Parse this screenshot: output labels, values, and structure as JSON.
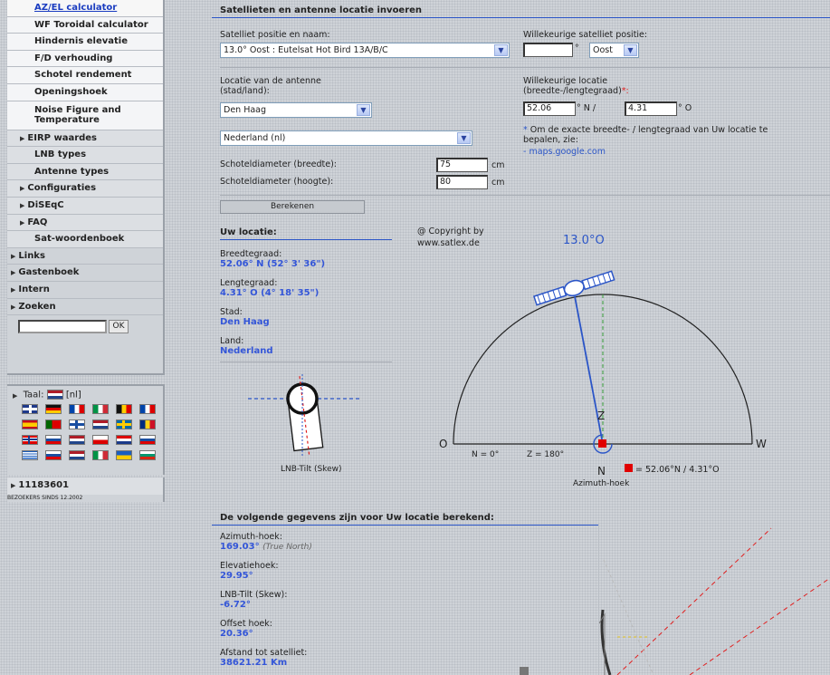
{
  "sidebar": {
    "menu": [
      {
        "label": "AZ/EL calculator",
        "arrow": "",
        "kind": "sub active"
      },
      {
        "label": "WF Toroidal calculator",
        "arrow": "",
        "kind": "sub"
      },
      {
        "label": "Hindernis elevatie",
        "arrow": "",
        "kind": "sub"
      },
      {
        "label": "F/D verhouding",
        "arrow": "",
        "kind": "sub"
      },
      {
        "label": "Schotel rendement",
        "arrow": "",
        "kind": "sub"
      },
      {
        "label": "Openingshoek",
        "arrow": "",
        "kind": "sub"
      },
      {
        "label": "Noise Figure and Temperature",
        "arrow": "",
        "kind": "sub tall"
      },
      {
        "label": "EIRP waardes",
        "arrow": "▶",
        "kind": "lvl1"
      },
      {
        "label": "LNB types",
        "arrow": "",
        "kind": "sub2"
      },
      {
        "label": "Antenne types",
        "arrow": "",
        "kind": "sub2"
      },
      {
        "label": "Configuraties",
        "arrow": "▶",
        "kind": "lvl1"
      },
      {
        "label": "DiSEqC",
        "arrow": "▶",
        "kind": "lvl1"
      },
      {
        "label": "FAQ",
        "arrow": "▶",
        "kind": "lvl1"
      },
      {
        "label": "Sat-woordenboek",
        "arrow": "",
        "kind": "sub2"
      },
      {
        "label": "Links",
        "arrow": "▶",
        "kind": "lvl0"
      },
      {
        "label": "Gastenboek",
        "arrow": "▶",
        "kind": "lvl0"
      },
      {
        "label": "Intern",
        "arrow": "▶",
        "kind": "lvl0"
      },
      {
        "label": "Zoeken",
        "arrow": "▶",
        "kind": "lvl0"
      }
    ],
    "search": {
      "value": "",
      "ok_label": "OK"
    },
    "language": {
      "label": "Taal:",
      "current": "[nl]",
      "arrow": "▶"
    },
    "counter": {
      "value": "11183601",
      "arrow": "▶",
      "since": "BEZOEKERS SINDS 12.2002"
    }
  },
  "form": {
    "title": "Satellieten en antenne locatie invoeren",
    "satellite_label": "Satelliet positie en naam:",
    "satellite_value": "13.0° Oost : Eutelsat Hot Bird 13A/B/C",
    "custom_sat_label": "Willekeurige satelliet positie:",
    "custom_sat_value": "",
    "custom_sat_unit": "°",
    "custom_sat_dir": "Oost",
    "location_label_1": "Locatie van de antenne",
    "location_label_2": "(stad/land):",
    "city_value": "Den Haag",
    "country_value": "Nederland (nl)",
    "custom_loc_label_1": "Willekeurige locatie",
    "custom_loc_label_2": "(breedte-/lengtegraad)",
    "custom_loc_star": "*:",
    "lat_value": "52.06",
    "lat_unit": "° N /",
    "lon_value": "4.31",
    "lon_unit": "° O",
    "hint_star": "*",
    "hint_text": "Om de exacte breedte- / lengtegraad van Uw locatie te bepalen, zie:",
    "hint_link": "- maps.google.com",
    "dish_width_label": "Schoteldiameter (breedte):",
    "dish_width_value": "75",
    "dish_height_label": "Schoteldiameter (hoogte):",
    "dish_height_value": "80",
    "dish_unit": "cm",
    "calc_button": "Berekenen"
  },
  "location": {
    "title": "Uw locatie:",
    "lat_label": "Breedtegraad:",
    "lat_value": "52.06° N (52° 3' 36\")",
    "lon_label": "Lengtegraad:",
    "lon_value": "4.31° O (4° 18' 35\")",
    "city_label": "Stad:",
    "city_value": "Den Haag",
    "country_label": "Land:",
    "country_value": "Nederland"
  },
  "diagram": {
    "copyright_1": "@ Copyright by",
    "copyright_2": "www.satlex.de",
    "sat_pos": "13.0°O",
    "label_o": "O",
    "label_w": "W",
    "label_z": "Z",
    "label_n": "N",
    "n_deg": "N = 0°",
    "z_deg": "Z = 180°",
    "location_legend": "= 52.06°N / 4.31°O",
    "azimuth_label": "Azimuth-hoek",
    "lnb_label": "LNB-Tilt (Skew)"
  },
  "results": {
    "title": "De volgende gegevens zijn voor Uw locatie berekend:",
    "azimuth_label": "Azimuth-hoek:",
    "azimuth_value": "169.03°",
    "azimuth_note": "(True North)",
    "elevation_label": "Elevatiehoek:",
    "elevation_value": "29.95°",
    "skew_label": "LNB-Tilt (Skew):",
    "skew_value": "-6.72°",
    "offset_label": "Offset hoek:",
    "offset_value": "20.36°",
    "distance_label": "Afstand tot satelliet:",
    "distance_value": "38621.21 Km"
  },
  "colors": {
    "accent": "#2b55c7",
    "value": "#3456d8",
    "marker": "#e00000"
  },
  "flags": [
    "gb",
    "de",
    "fr",
    "it",
    "be",
    "fr2",
    "es",
    "pt",
    "fi",
    "nl",
    "se",
    "ro",
    "no",
    "ru",
    "nl2",
    "cz",
    "hr",
    "sk",
    "gr",
    "si",
    "nl3",
    "it2",
    "ua",
    "bg"
  ]
}
